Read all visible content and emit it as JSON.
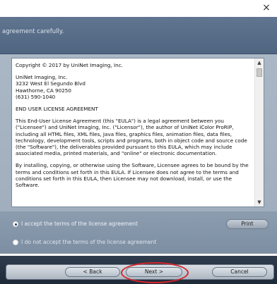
{
  "window": {
    "close_glyph": "×"
  },
  "header": {
    "instruction": "agreement carefully."
  },
  "eula": {
    "copyright": "Copyright © 2017 by UniNet Imaging, Inc.",
    "address": "UniNet Imaging, Inc.\n3232 West El Segundo Blvd\nHawthorne, CA 90250\n(631) 590-1040",
    "heading": "END USER LICENSE AGREEMENT",
    "para1": "This End-User License Agreement (this \"EULA\") is a legal agreement between you (\"Licensee\") and UniNet Imaging, Inc. (\"Licensor\"), the author of UniNet iColor ProRIP, including all HTML files, XML files, Java files, graphics files, animation files, data files, technology, development tools, scripts and programs, both in object code and source code (the \"Software\"), the deliverables provided pursuant to this EULA, which may include associated media, printed materials, and \"online\" or electronic documentation.",
    "para2": "By installing, copying, or otherwise using the Software, Licensee agrees to be bound by the terms and conditions set forth in this EULA. If Licensee does not agree to the terms and conditions set forth in this EULA, then Licensee may not download, install, or use the Software."
  },
  "options": {
    "accept_label": "I accept the terms of the license agreement",
    "decline_label": "I do not accept the terms of the license agreement",
    "selected": "accept",
    "print_label": "Print"
  },
  "footer": {
    "back_label": "< Back",
    "next_label": "Next >",
    "cancel_label": "Cancel"
  },
  "colors": {
    "header": "#5f7590",
    "annotation_ring": "#d3262c"
  }
}
